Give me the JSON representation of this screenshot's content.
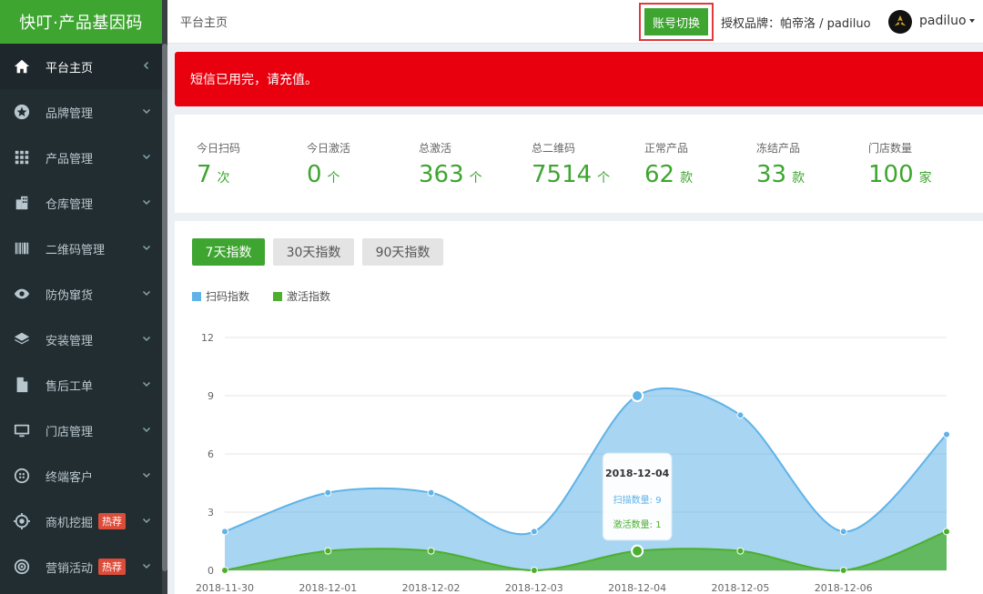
{
  "app": {
    "title": "快叮·产品基因码"
  },
  "sidebar": {
    "items": [
      {
        "label": "平台主页",
        "icon": "home-icon",
        "active": true,
        "hot": ""
      },
      {
        "label": "品牌管理",
        "icon": "star-icon",
        "active": false,
        "hot": ""
      },
      {
        "label": "产品管理",
        "icon": "grid-icon",
        "active": false,
        "hot": ""
      },
      {
        "label": "仓库管理",
        "icon": "building-icon",
        "active": false,
        "hot": ""
      },
      {
        "label": "二维码管理",
        "icon": "barcode-icon",
        "active": false,
        "hot": ""
      },
      {
        "label": "防伪窜货",
        "icon": "eye-icon",
        "active": false,
        "hot": ""
      },
      {
        "label": "安装管理",
        "icon": "layers-icon",
        "active": false,
        "hot": ""
      },
      {
        "label": "售后工单",
        "icon": "file-icon",
        "active": false,
        "hot": ""
      },
      {
        "label": "门店管理",
        "icon": "monitor-icon",
        "active": false,
        "hot": ""
      },
      {
        "label": "终端客户",
        "icon": "globe-icon",
        "active": false,
        "hot": ""
      },
      {
        "label": "商机挖掘",
        "icon": "crosshair-icon",
        "active": false,
        "hot": "热荐"
      },
      {
        "label": "营销活动",
        "icon": "broadcast-icon",
        "active": false,
        "hot": "热荐"
      }
    ]
  },
  "header": {
    "breadcrumb": "平台主页",
    "switch_label": "账号切换",
    "brand_text": "授权品牌：帕帝洛 / padiluo",
    "user_name": "padiluo"
  },
  "alert": {
    "text": "短信已用完，请充值。"
  },
  "stats": [
    {
      "label": "今日扫码",
      "value": "7",
      "unit": "次"
    },
    {
      "label": "今日激活",
      "value": "0",
      "unit": "个"
    },
    {
      "label": "总激活",
      "value": "363",
      "unit": "个"
    },
    {
      "label": "总二维码",
      "value": "7514",
      "unit": "个"
    },
    {
      "label": "正常产品",
      "value": "62",
      "unit": "款"
    },
    {
      "label": "冻结产品",
      "value": "33",
      "unit": "款"
    },
    {
      "label": "门店数量",
      "value": "100",
      "unit": "家"
    }
  ],
  "tabs": [
    {
      "label": "7天指数",
      "active": true
    },
    {
      "label": "30天指数",
      "active": false
    },
    {
      "label": "90天指数",
      "active": false
    }
  ],
  "colors": {
    "green": "#3ea530",
    "scan": "#5fb3e8",
    "activate": "#4caf2e",
    "alert": "#e8000e"
  },
  "chart_data": {
    "type": "area",
    "x": [
      "2018-11-30",
      "2018-12-01",
      "2018-12-02",
      "2018-12-03",
      "2018-12-04",
      "2018-12-05",
      "2018-12-06",
      ""
    ],
    "x_tick_labels": [
      "2018-11-30",
      "2018-12-01",
      "2018-12-02",
      "2018-12-03",
      "2018-12-04",
      "2018-12-05",
      "2018-12-06"
    ],
    "y_ticks": [
      0,
      3,
      6,
      9,
      12
    ],
    "ylim": [
      0,
      12
    ],
    "grid": true,
    "legend_position": "top-left",
    "series": [
      {
        "name": "扫码指数",
        "values": [
          2,
          4,
          4,
          2,
          9,
          8,
          2,
          7
        ]
      },
      {
        "name": "激活指数",
        "values": [
          0,
          1,
          1,
          0,
          1,
          1,
          0,
          2
        ]
      }
    ],
    "tooltip": {
      "date": "2018-12-04",
      "scan_line": "扫描数量: 9",
      "activate_line": "激活数量: 1"
    }
  }
}
